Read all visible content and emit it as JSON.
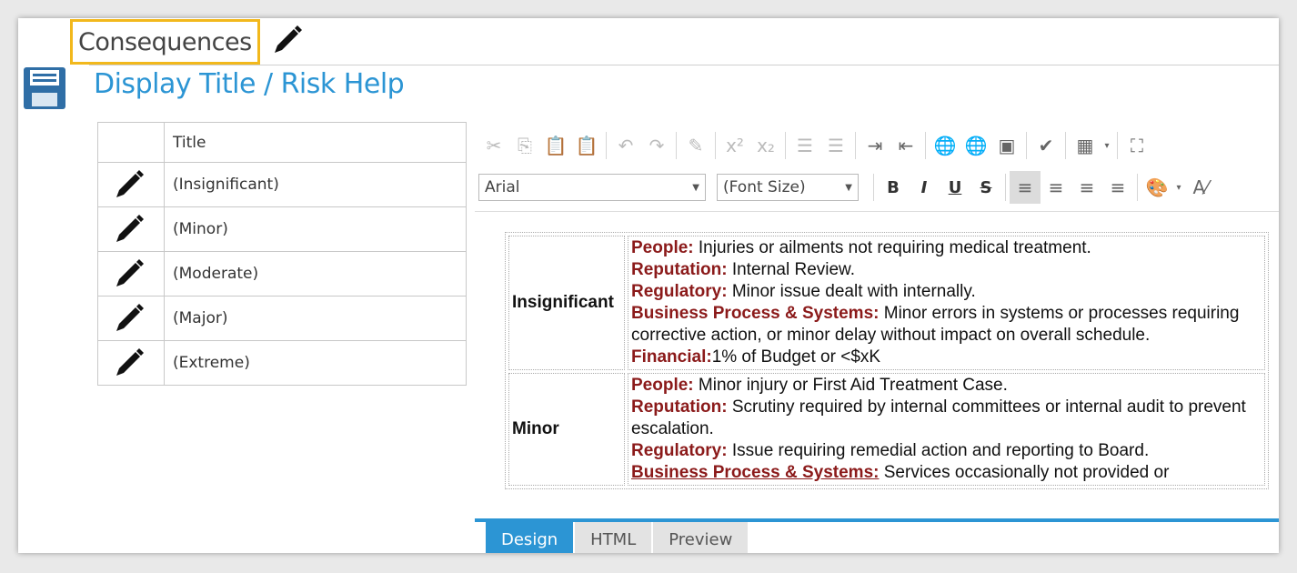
{
  "page": {
    "title": "Consequences",
    "subtitle": "Display Title / Risk Help"
  },
  "levels_table": {
    "header": "Title",
    "rows": [
      {
        "label": "(Insignificant)"
      },
      {
        "label": "(Minor)"
      },
      {
        "label": "(Moderate)"
      },
      {
        "label": "(Major)"
      },
      {
        "label": "(Extreme)"
      }
    ]
  },
  "editor": {
    "font_family": "Arial",
    "font_size": "(Font Size)",
    "format_buttons": {
      "bold": "B",
      "italic": "I",
      "underline": "U",
      "strike": "S"
    },
    "toolbar_icons": [
      "cut-icon",
      "copy-icon",
      "paste-icon",
      "paste-from-word-icon",
      "undo-icon",
      "redo-icon",
      "format-stripper-icon",
      "superscript-icon",
      "subscript-icon",
      "ordered-list-icon",
      "unordered-list-icon",
      "indent-icon",
      "outdent-icon",
      "insert-link-icon",
      "remove-link-icon",
      "insert-image-icon",
      "spellcheck-icon",
      "insert-table-icon",
      "fullscreen-icon",
      "align-left-icon",
      "align-center-icon",
      "align-right-icon",
      "justify-icon",
      "text-color-icon",
      "clear-format-icon"
    ],
    "content": [
      {
        "level": "Insignificant",
        "items": [
          {
            "category": "People:",
            "text": " Injuries or ailments not requiring medical treatment."
          },
          {
            "category": "Reputation:",
            "text": " Internal Review."
          },
          {
            "category": "Regulatory:",
            "text": " Minor issue dealt with internally."
          },
          {
            "category": "Business Process & Systems:",
            "text": " Minor errors in systems or processes requiring corrective action, or minor delay without impact on overall schedule."
          },
          {
            "category": "Financial:",
            "text": "1% of Budget or <$xK"
          }
        ]
      },
      {
        "level": "Minor",
        "items": [
          {
            "category": "People:",
            "text": " Minor injury or First Aid Treatment Case."
          },
          {
            "category": "Reputation:",
            "text": " Scrutiny required by internal committees or internal audit to prevent escalation."
          },
          {
            "category": "Regulatory:",
            "text": " Issue requiring remedial action and reporting to Board."
          },
          {
            "category": "Business Process & Systems:",
            "text": " Services occasionally not provided or"
          }
        ]
      }
    ],
    "tabs": [
      "Design",
      "HTML",
      "Preview"
    ],
    "active_tab": "Design"
  },
  "colors": {
    "accent": "#2c95d4",
    "highlight_border": "#f2b81c",
    "category_text": "#8b1a1a"
  }
}
